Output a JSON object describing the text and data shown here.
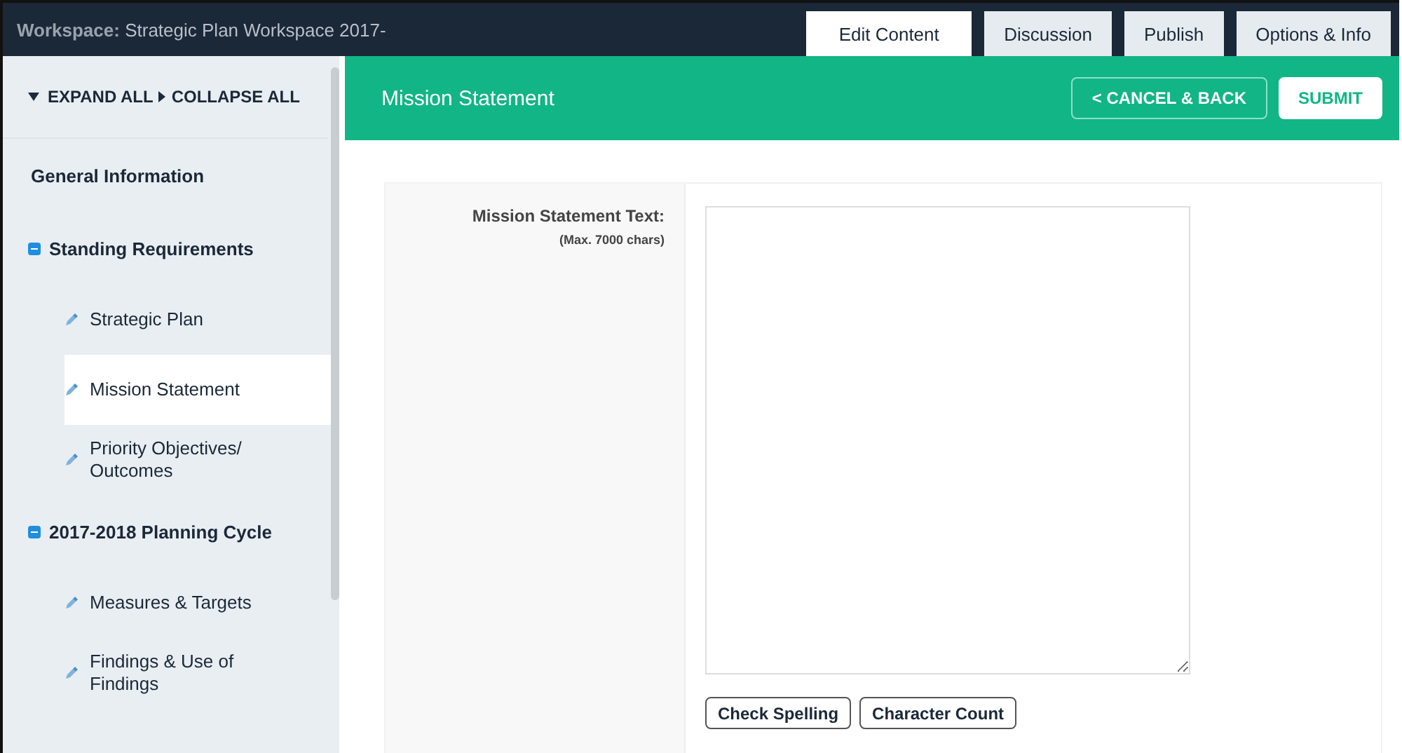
{
  "topbar": {
    "workspace_label": "Workspace:",
    "workspace_name": "Strategic Plan Workspace 2017-"
  },
  "tabs": [
    {
      "label": "Edit Content",
      "selected": true
    },
    {
      "label": "Discussion",
      "selected": false
    },
    {
      "label": "Publish",
      "selected": false
    },
    {
      "label": "Options & Info",
      "selected": false
    }
  ],
  "sidebar": {
    "expand_all": "EXPAND ALL",
    "collapse_all": "COLLAPSE ALL",
    "items": [
      {
        "kind": "heading",
        "label": "General Information"
      },
      {
        "kind": "group",
        "label": "Standing Requirements",
        "expanded": true,
        "children": [
          {
            "label": "Strategic Plan",
            "selected": false
          },
          {
            "label": "Mission Statement",
            "selected": true
          },
          {
            "label": "Priority Objectives/ Outcomes",
            "selected": false
          }
        ]
      },
      {
        "kind": "group",
        "label": "2017-2018 Planning Cycle",
        "expanded": true,
        "children": [
          {
            "label": "Measures & Targets",
            "selected": false
          },
          {
            "label": "Findings & Use of Findings",
            "selected": false
          }
        ]
      }
    ]
  },
  "header": {
    "title": "Mission Statement",
    "cancel_button": "< CANCEL & BACK",
    "submit_button": "SUBMIT"
  },
  "form": {
    "label": "Mission Statement Text:",
    "hint": "(Max. 7000 chars)",
    "buttons": [
      "Check Spelling",
      "Character Count"
    ]
  }
}
